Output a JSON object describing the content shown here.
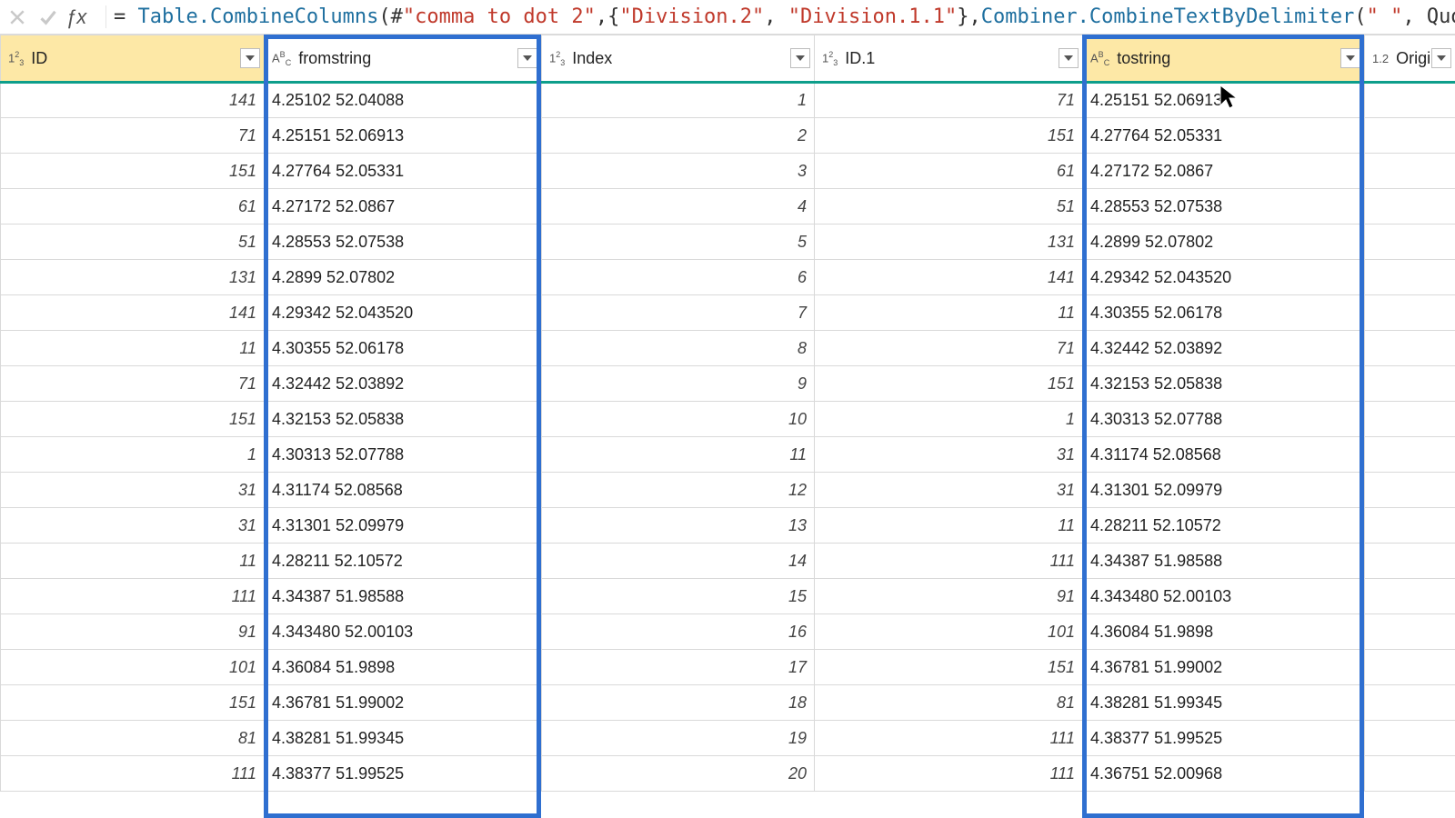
{
  "formula": {
    "prefix": "= ",
    "fn1": "Table.CombineColumns",
    "paren1": "(#",
    "str1": "\"comma to dot 2\"",
    "mid1": ",{",
    "str2": "\"Division.2\"",
    "mid2": ", ",
    "str3": "\"Division.1.1\"",
    "mid3": "},",
    "fn2": "Combiner.CombineTextByDelimiter",
    "paren2": "(",
    "str4": "\" \"",
    "suffix": ", QuoteSt"
  },
  "columns": [
    {
      "name": "ID",
      "type": "num",
      "selected": true,
      "class": "col-id"
    },
    {
      "name": "fromstring",
      "type": "text",
      "selected": false,
      "class": "col-from"
    },
    {
      "name": "Index",
      "type": "num",
      "selected": false,
      "class": "col-index"
    },
    {
      "name": "ID.1",
      "type": "num",
      "selected": false,
      "class": "col-id1"
    },
    {
      "name": "tostring",
      "type": "text",
      "selected": true,
      "class": "col-to"
    },
    {
      "name": "Origin",
      "type": "dec",
      "selected": false,
      "class": "col-origin"
    }
  ],
  "type_icons": {
    "num": "1²₃",
    "text": "AᴮC",
    "dec": "1.2"
  },
  "rows": [
    {
      "id": "141",
      "from": "4.25102 52.04088",
      "idx": "1",
      "id1": "71",
      "to": "4.25151 52.06913"
    },
    {
      "id": "71",
      "from": "4.25151 52.06913",
      "idx": "2",
      "id1": "151",
      "to": "4.27764 52.05331"
    },
    {
      "id": "151",
      "from": "4.27764 52.05331",
      "idx": "3",
      "id1": "61",
      "to": "4.27172 52.0867"
    },
    {
      "id": "61",
      "from": "4.27172 52.0867",
      "idx": "4",
      "id1": "51",
      "to": "4.28553 52.07538"
    },
    {
      "id": "51",
      "from": "4.28553 52.07538",
      "idx": "5",
      "id1": "131",
      "to": "4.2899 52.07802"
    },
    {
      "id": "131",
      "from": "4.2899 52.07802",
      "idx": "6",
      "id1": "141",
      "to": "4.29342 52.043520"
    },
    {
      "id": "141",
      "from": "4.29342 52.043520",
      "idx": "7",
      "id1": "11",
      "to": "4.30355 52.06178"
    },
    {
      "id": "11",
      "from": "4.30355 52.06178",
      "idx": "8",
      "id1": "71",
      "to": "4.32442 52.03892"
    },
    {
      "id": "71",
      "from": "4.32442 52.03892",
      "idx": "9",
      "id1": "151",
      "to": "4.32153 52.05838"
    },
    {
      "id": "151",
      "from": "4.32153 52.05838",
      "idx": "10",
      "id1": "1",
      "to": "4.30313 52.07788"
    },
    {
      "id": "1",
      "from": "4.30313 52.07788",
      "idx": "11",
      "id1": "31",
      "to": "4.31174 52.08568"
    },
    {
      "id": "31",
      "from": "4.31174 52.08568",
      "idx": "12",
      "id1": "31",
      "to": "4.31301 52.09979"
    },
    {
      "id": "31",
      "from": "4.31301 52.09979",
      "idx": "13",
      "id1": "11",
      "to": "4.28211 52.10572"
    },
    {
      "id": "11",
      "from": "4.28211 52.10572",
      "idx": "14",
      "id1": "111",
      "to": "4.34387 51.98588"
    },
    {
      "id": "111",
      "from": "4.34387 51.98588",
      "idx": "15",
      "id1": "91",
      "to": "4.343480 52.00103"
    },
    {
      "id": "91",
      "from": "4.343480 52.00103",
      "idx": "16",
      "id1": "101",
      "to": "4.36084 51.9898"
    },
    {
      "id": "101",
      "from": "4.36084 51.9898",
      "idx": "17",
      "id1": "151",
      "to": "4.36781 51.99002"
    },
    {
      "id": "151",
      "from": "4.36781 51.99002",
      "idx": "18",
      "id1": "81",
      "to": "4.38281 51.99345"
    },
    {
      "id": "81",
      "from": "4.38281 51.99345",
      "idx": "19",
      "id1": "111",
      "to": "4.38377 51.99525"
    },
    {
      "id": "111",
      "from": "4.38377 51.99525",
      "idx": "20",
      "id1": "111",
      "to": "4.36751 52.00968"
    }
  ]
}
